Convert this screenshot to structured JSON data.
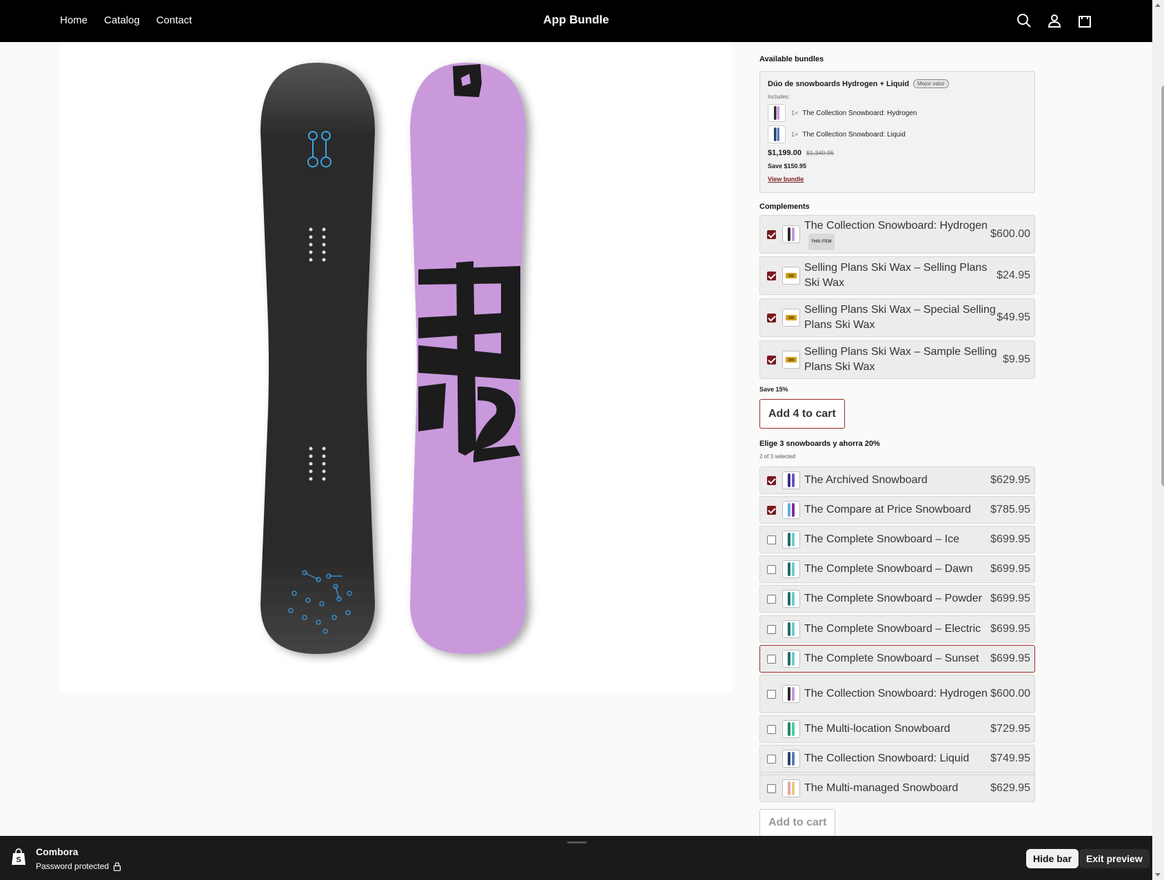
{
  "header": {
    "nav": [
      "Home",
      "Catalog",
      "Contact"
    ],
    "brand": "App Bundle",
    "icons": [
      "search-icon",
      "account-icon",
      "cart-icon"
    ]
  },
  "bundles": {
    "title": "Available bundles",
    "card": {
      "name": "Dúo de snowboards Hydrogen + Liquid",
      "badge": "Mejor valor",
      "includes_label": "Includes:",
      "items": [
        {
          "qty": "1×",
          "name": "The Collection Snowboard: Hydrogen"
        },
        {
          "qty": "1×",
          "name": "The Collection Snowboard: Liquid"
        }
      ],
      "price": "$1,199.00",
      "compare_price": "$1,349.95",
      "save": "Save $150.95",
      "link": "View bundle"
    }
  },
  "complements": {
    "title": "Complements",
    "this_item_tag": "THIS ITEM",
    "items": [
      {
        "name": "The Collection Snowboard: Hydrogen",
        "price": "$600.00",
        "checked": true
      },
      {
        "name": "Selling Plans Ski Wax – Selling Plans Ski Wax",
        "price": "$24.95",
        "checked": true
      },
      {
        "name": "Selling Plans Ski Wax – Special Selling Plans Ski Wax",
        "price": "$49.95",
        "checked": true
      },
      {
        "name": "Selling Plans Ski Wax – Sample Selling Plans Ski Wax",
        "price": "$9.95",
        "checked": true
      }
    ],
    "save": "Save 15%",
    "button": "Add 4 to cart"
  },
  "mix": {
    "title": "Elige 3 snowboards y ahorra 20%",
    "status": "2 of 3 selected",
    "items": [
      {
        "name": "The Archived Snowboard",
        "price": "$629.95",
        "checked": true
      },
      {
        "name": "The Compare at Price Snowboard",
        "price": "$785.95",
        "checked": true
      },
      {
        "name": "The Complete Snowboard – Ice",
        "price": "$699.95",
        "checked": false
      },
      {
        "name": "The Complete Snowboard – Dawn",
        "price": "$699.95",
        "checked": false
      },
      {
        "name": "The Complete Snowboard – Powder",
        "price": "$699.95",
        "checked": false
      },
      {
        "name": "The Complete Snowboard – Electric",
        "price": "$699.95",
        "checked": false
      },
      {
        "name": "The Complete Snowboard – Sunset",
        "price": "$699.95",
        "checked": false
      },
      {
        "name": "The Collection Snowboard: Hydrogen",
        "price": "$600.00",
        "checked": false
      },
      {
        "name": "The Multi-location Snowboard",
        "price": "$729.95",
        "checked": false
      },
      {
        "name": "The Collection Snowboard: Liquid",
        "price": "$749.95",
        "checked": false
      },
      {
        "name": "The Multi-managed Snowboard",
        "price": "$629.95",
        "checked": false
      }
    ],
    "button": "Add to cart"
  },
  "preview_bar": {
    "store": "Combora",
    "status": "Password protected",
    "hide": "Hide bar",
    "exit": "Exit preview"
  },
  "colors": {
    "accent": "#7a1820",
    "board_dark": "#2b2b2b",
    "board_purple": "#c999dc"
  }
}
